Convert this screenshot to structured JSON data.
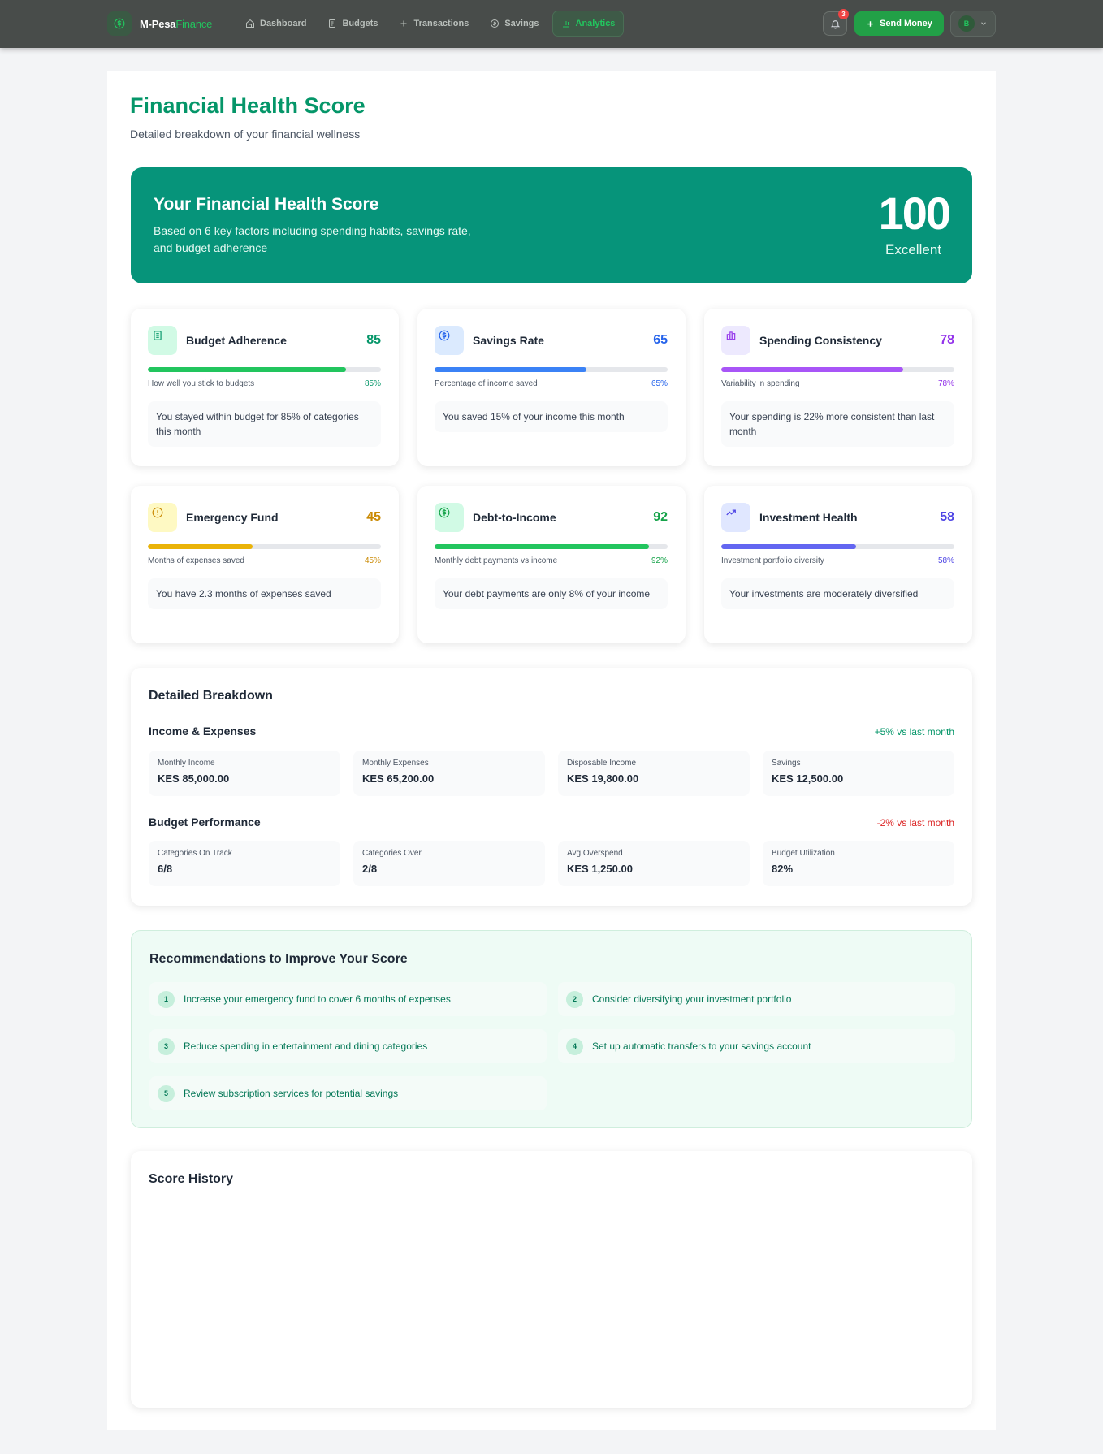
{
  "nav": {
    "brand": "M-Pesa",
    "brand_accent": "Finance",
    "links": [
      {
        "label": "Dashboard",
        "icon": "home-icon"
      },
      {
        "label": "Budgets",
        "icon": "clipboard-icon"
      },
      {
        "label": "Transactions",
        "icon": "plus-icon"
      },
      {
        "label": "Savings",
        "icon": "coin-icon"
      },
      {
        "label": "Analytics",
        "icon": "bar-chart-icon",
        "active": true
      }
    ],
    "notification_count": "3",
    "send_money_label": "Send Money",
    "avatar_initial": "B"
  },
  "page": {
    "title": "Financial Health Score",
    "subtitle": "Detailed breakdown of your financial wellness"
  },
  "hero": {
    "title": "Your Financial Health Score",
    "description": "Based on 6 key factors including spending habits, savings rate, and budget adherence",
    "score": "100",
    "rating": "Excellent"
  },
  "cards": [
    {
      "title": "Budget Adherence",
      "score": "85",
      "percent": "85%",
      "fill": 0.85,
      "description": "How well you stick to budgets",
      "note": "You stayed within budget for 85% of categories this month",
      "color": "#059669",
      "bar_color": "#22c55e",
      "icon_bg": "#d1fae5",
      "icon": "document-icon"
    },
    {
      "title": "Savings Rate",
      "score": "65",
      "percent": "65%",
      "fill": 0.65,
      "description": "Percentage of income saved",
      "note": "You saved 15% of your income this month",
      "color": "#2563eb",
      "bar_color": "#3b82f6",
      "icon_bg": "#dbeafe",
      "icon": "dollar-icon"
    },
    {
      "title": "Spending Consistency",
      "score": "78",
      "percent": "78%",
      "fill": 0.78,
      "description": "Variability in spending",
      "note": "Your spending is 22% more consistent than last month",
      "color": "#9333ea",
      "bar_color": "#a855f7",
      "icon_bg": "#ede9fe",
      "icon": "bar-chart-icon"
    },
    {
      "title": "Emergency Fund",
      "score": "45",
      "percent": "45%",
      "fill": 0.45,
      "description": "Months of expenses saved",
      "note": "You have 2.3 months of expenses saved",
      "color": "#ca8a04",
      "bar_color": "#eab308",
      "icon_bg": "#fef9c3",
      "icon": "alert-icon"
    },
    {
      "title": "Debt-to-Income",
      "score": "92",
      "percent": "92%",
      "fill": 0.92,
      "description": "Monthly debt payments vs income",
      "note": "Your debt payments are only 8% of your income",
      "color": "#16a34a",
      "bar_color": "#22c55e",
      "icon_bg": "#d1fae5",
      "icon": "dollar-icon"
    },
    {
      "title": "Investment Health",
      "score": "58",
      "percent": "58%",
      "fill": 0.58,
      "description": "Investment portfolio diversity",
      "note": "Your investments are moderately diversified",
      "color": "#4f46e5",
      "bar_color": "#6366f1",
      "icon_bg": "#e0e7ff",
      "icon": "trend-up-icon"
    }
  ],
  "breakdown": {
    "title": "Detailed Breakdown",
    "income": {
      "title": "Income & Expenses",
      "trend": "+5% vs last month",
      "trend_color": "#059669",
      "stats": [
        {
          "label": "Monthly Income",
          "value": "KES 85,000.00"
        },
        {
          "label": "Monthly Expenses",
          "value": "KES 65,200.00"
        },
        {
          "label": "Disposable Income",
          "value": "KES 19,800.00"
        },
        {
          "label": "Savings",
          "value": "KES 12,500.00"
        }
      ]
    },
    "budget": {
      "title": "Budget Performance",
      "trend": "-2% vs last month",
      "trend_color": "#dc2626",
      "stats": [
        {
          "label": "Categories On Track",
          "value": "6/8"
        },
        {
          "label": "Categories Over",
          "value": "2/8"
        },
        {
          "label": "Avg Overspend",
          "value": "KES 1,250.00"
        },
        {
          "label": "Budget Utilization",
          "value": "82%"
        }
      ]
    }
  },
  "recommendations": {
    "title": "Recommendations to Improve Your Score",
    "items": [
      {
        "num": "1",
        "text": "Increase your emergency fund to cover 6 months of expenses"
      },
      {
        "num": "2",
        "text": "Consider diversifying your investment portfolio"
      },
      {
        "num": "3",
        "text": "Reduce spending in entertainment and dining categories"
      },
      {
        "num": "4",
        "text": "Set up automatic transfers to your savings account"
      },
      {
        "num": "5",
        "text": "Review subscription services for potential savings"
      }
    ]
  },
  "history": {
    "title": "Score History"
  }
}
